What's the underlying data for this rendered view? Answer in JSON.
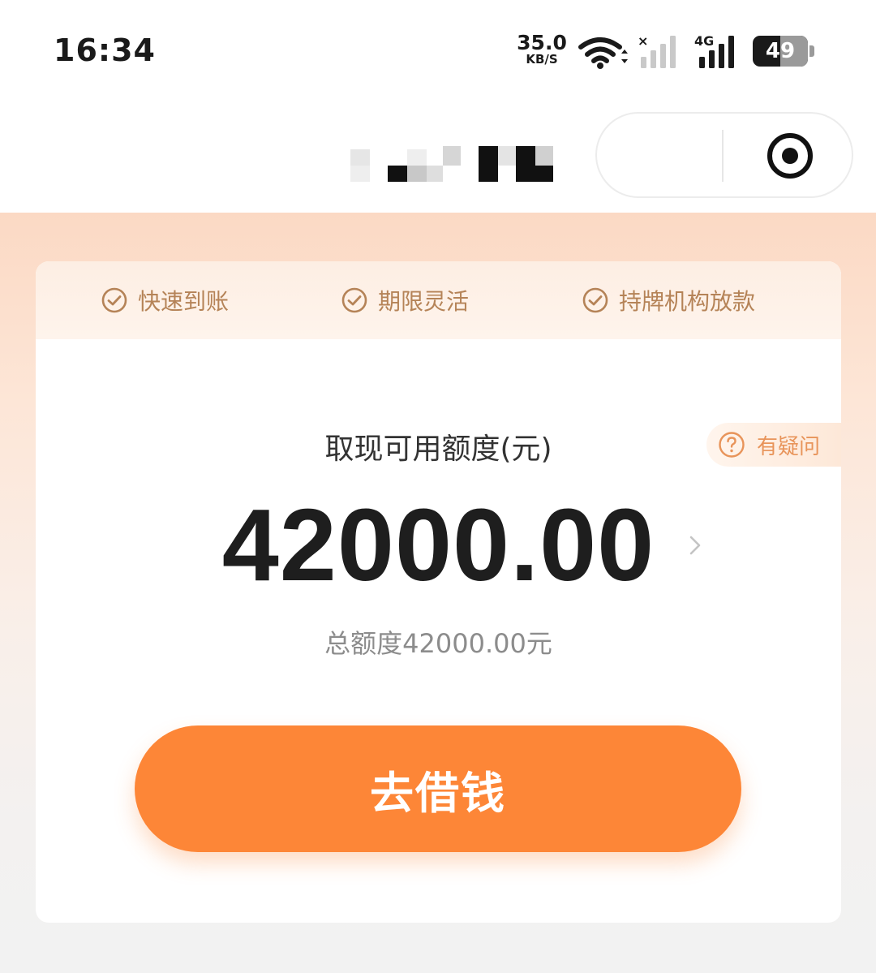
{
  "status_bar": {
    "time": "16:34",
    "net_speed_value": "35.0",
    "net_speed_unit": "KB/S",
    "network_type": "4G",
    "battery_level": "49"
  },
  "nav_bar": {
    "title_obscured": true
  },
  "features": [
    {
      "label": "快速到账",
      "icon": "check-circle-icon"
    },
    {
      "label": "期限灵活",
      "icon": "check-circle-icon"
    },
    {
      "label": "持牌机构放款",
      "icon": "check-circle-icon"
    }
  ],
  "help": {
    "label": "有疑问",
    "icon": "question-circle-icon"
  },
  "credit": {
    "label": "取现可用额度(元)",
    "amount": "42000.00",
    "total_label": "总额度42000.00元"
  },
  "action": {
    "borrow_label": "去借钱"
  },
  "colors": {
    "accent": "#fd8637",
    "feature_text": "#b58357",
    "help_text": "#e8945a"
  }
}
